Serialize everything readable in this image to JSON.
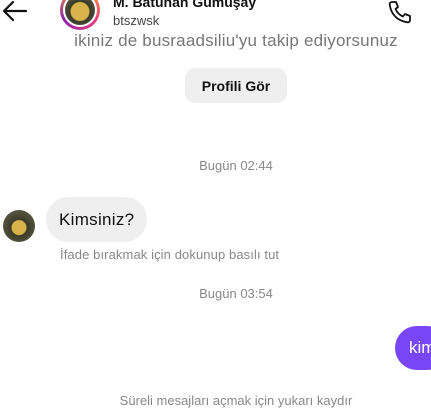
{
  "header": {
    "name": "M. Batuhan Gümüşay",
    "username": "btszwsk",
    "back_icon": "arrow-left-icon",
    "call_icon": "phone-icon"
  },
  "profile": {
    "follow_text": "ikiniz de busraadsiliu'yu takip ediyorsunuz",
    "view_profile_label": "Profili Gör"
  },
  "messages": {
    "timestamp_1": "Bugün 02:44",
    "incoming_text": "Kimsiniz?",
    "react_hint": "İfade bırakmak için dokunup basılı tut",
    "timestamp_2": "Bugün 03:54",
    "outgoing_text": "kim"
  },
  "footer": {
    "vanish_hint": "Süreli mesajları açmak için yukarı kaydır"
  },
  "colors": {
    "outgoing_bubble": "#7a45f6",
    "incoming_bubble": "#efefef"
  }
}
